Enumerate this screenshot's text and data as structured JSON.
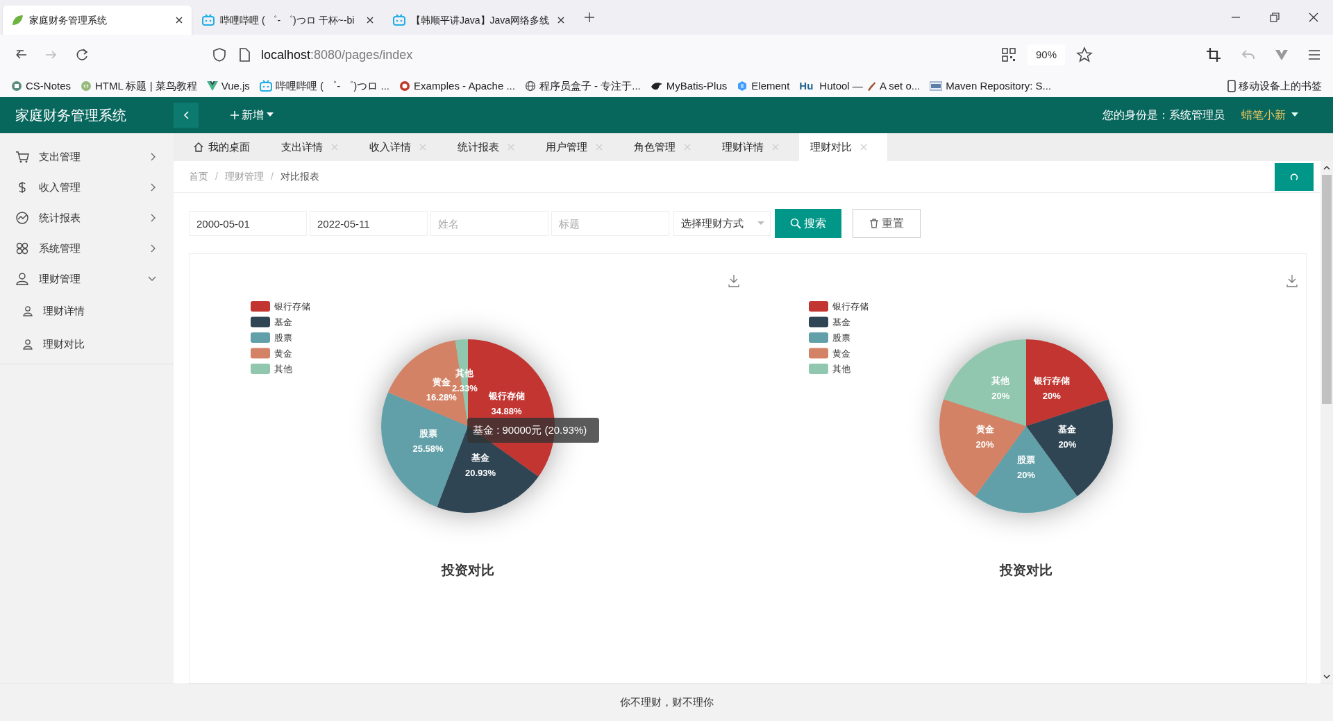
{
  "browser": {
    "tabs": [
      {
        "kind": "leaf",
        "title": "家庭财务管理系统",
        "selected": true
      },
      {
        "kind": "tv",
        "title": "哔哩哔哩 ( ゜- ゜)つロ 干杯~-bi",
        "selected": false
      },
      {
        "kind": "tv",
        "title": "【韩顺平讲Java】Java网络多线",
        "selected": false
      }
    ],
    "url_host": "localhost",
    "url_path": ":8080/pages/index",
    "zoom": "90%",
    "bookmarks": [
      {
        "kind": "notes",
        "label": "CS-Notes"
      },
      {
        "kind": "html",
        "label": "HTML 标题 | 菜鸟教程"
      },
      {
        "kind": "vue",
        "label": "Vue.js"
      },
      {
        "kind": "tv",
        "label": "哔哩哔哩 ( ゜- ゜)つロ ..."
      },
      {
        "kind": "apache",
        "label": "Examples - Apache ..."
      },
      {
        "kind": "globe",
        "label": "程序员盒子 - 专注于..."
      },
      {
        "kind": "bird",
        "label": "MyBatis-Plus"
      },
      {
        "kind": "element",
        "label": "Element"
      },
      {
        "kind": "hu",
        "badge": "Hu",
        "label": "Hutool —",
        "suffix": "A set o..."
      },
      {
        "kind": "mvn",
        "label": "Maven Repository: S..."
      }
    ],
    "mobile_bookmarks": "移动设备上的书签"
  },
  "app": {
    "title": "家庭财务管理系统",
    "new_button": "新增",
    "identity": "您的身份是：系统管理员",
    "user": "蜡笔小新"
  },
  "sidebar": {
    "items": [
      {
        "kind": "cart",
        "label": "支出管理",
        "expanded": false
      },
      {
        "kind": "dollar",
        "label": "收入管理",
        "expanded": false
      },
      {
        "kind": "chart",
        "label": "统计报表",
        "expanded": false
      },
      {
        "kind": "grid",
        "label": "系统管理",
        "expanded": false
      },
      {
        "kind": "user",
        "label": "理财管理",
        "expanded": true,
        "children": [
          {
            "label": "理财详情"
          },
          {
            "label": "理财对比"
          }
        ]
      }
    ]
  },
  "tabs": [
    {
      "kind": "home",
      "label": "我的桌面",
      "selected": false
    },
    {
      "kind": "page",
      "label": "支出详情",
      "selected": false
    },
    {
      "kind": "page",
      "label": "收入详情",
      "selected": false
    },
    {
      "kind": "page",
      "label": "统计报表",
      "selected": false
    },
    {
      "kind": "page",
      "label": "用户管理",
      "selected": false
    },
    {
      "kind": "page",
      "label": "角色管理",
      "selected": false
    },
    {
      "kind": "page",
      "label": "理财详情",
      "selected": false
    },
    {
      "kind": "page",
      "label": "理财对比",
      "selected": true
    }
  ],
  "breadcrumb": [
    {
      "label": "首页"
    },
    {
      "separator": "/",
      "label": "理财管理"
    },
    {
      "separator": "/",
      "label": "对比报表"
    }
  ],
  "filters": [
    {
      "kind": "input",
      "value": "2000-05-01"
    },
    {
      "kind": "input",
      "value": "2022-05-11"
    },
    {
      "kind": "input",
      "placeholder": "姓名"
    },
    {
      "kind": "input",
      "placeholder": "标题"
    },
    {
      "kind": "select",
      "placeholder": "选择理财方式"
    }
  ],
  "buttons": [
    {
      "kind": "primary",
      "label": "搜索"
    },
    {
      "kind": "default",
      "label": "重置"
    }
  ],
  "charts": [
    {
      "legend": [
        {
          "label": "银行存储",
          "color": "#c23531"
        },
        {
          "label": "基金",
          "color": "#2f4554"
        },
        {
          "label": "股票",
          "color": "#61a0a8"
        },
        {
          "label": "黄金",
          "color": "#d48265"
        },
        {
          "label": "其他",
          "color": "#91c7ae"
        }
      ],
      "tooltip": "基金 : 90000元 (20.93%)",
      "chart_data": {
        "type": "pie",
        "title": "投资对比",
        "categories": [
          "银行存储",
          "基金",
          "股票",
          "黄金",
          "其他"
        ],
        "values": [
          34.88,
          20.93,
          25.58,
          16.28,
          2.33
        ],
        "value_labels": [
          "34.88%",
          "20.93%",
          "25.58%",
          "16.28%",
          "2.33%"
        ]
      }
    },
    {
      "legend": [
        {
          "label": "银行存储",
          "color": "#c23531"
        },
        {
          "label": "基金",
          "color": "#2f4554"
        },
        {
          "label": "股票",
          "color": "#61a0a8"
        },
        {
          "label": "黄金",
          "color": "#d48265"
        },
        {
          "label": "其他",
          "color": "#91c7ae"
        }
      ],
      "chart_data": {
        "type": "pie",
        "title": "投资对比",
        "categories": [
          "银行存储",
          "基金",
          "股票",
          "黄金",
          "其他"
        ],
        "values": [
          20,
          20,
          20,
          20,
          20
        ],
        "value_labels": [
          "20%",
          "20%",
          "20%",
          "20%",
          "20%"
        ]
      }
    }
  ],
  "footer": "你不理财，财不理你"
}
